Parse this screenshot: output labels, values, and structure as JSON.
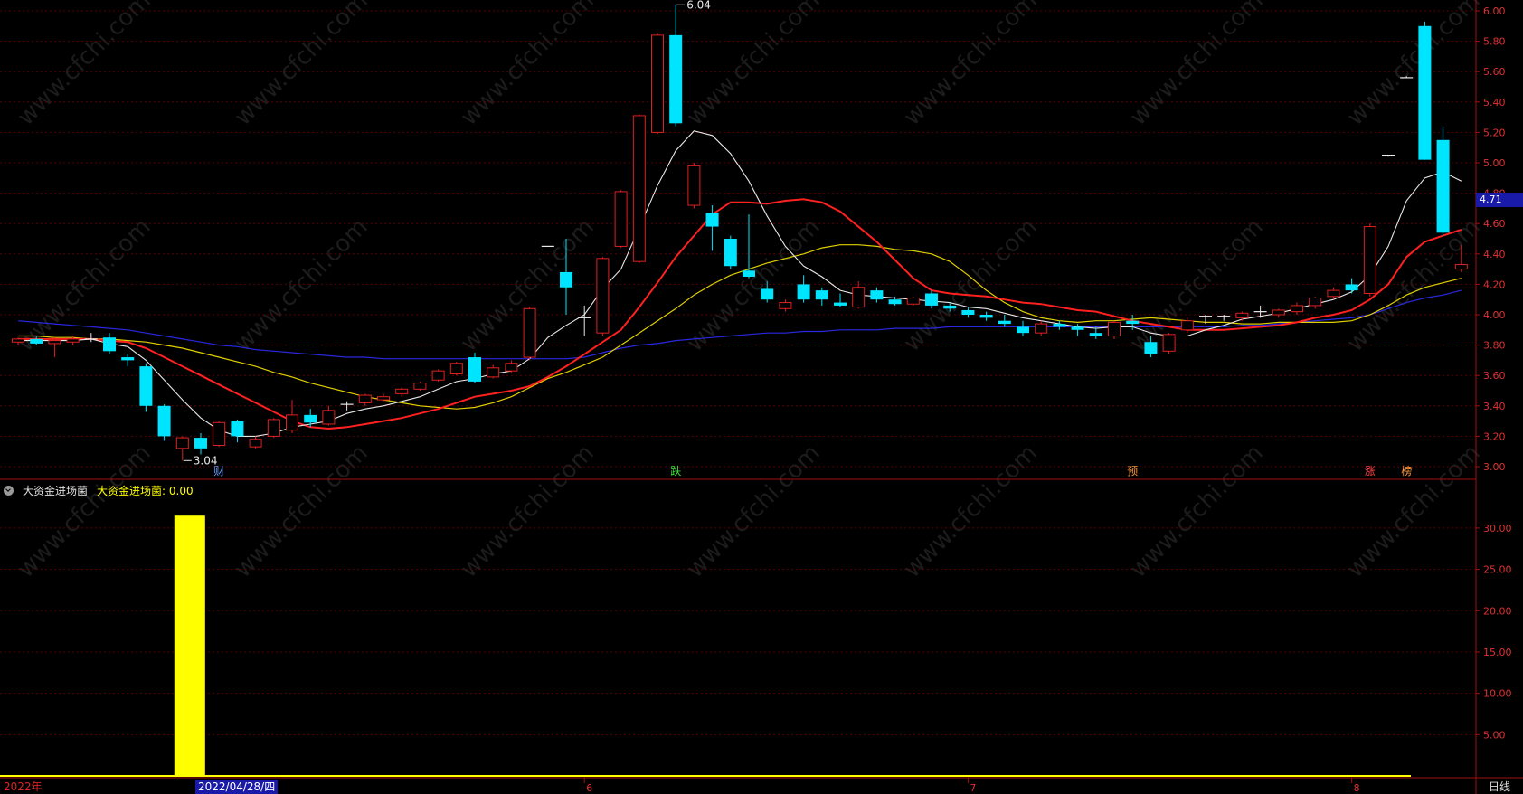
{
  "app": {
    "period_label": "日线",
    "year_label": "2022年",
    "cursor_date": "2022/04/28/四",
    "watermark": "www.cfchi.com"
  },
  "colors": {
    "background": "#000000",
    "up": "#e02020",
    "down": "#00e5ff",
    "ma5": "#e8e8e8",
    "ma10": "#ff2020",
    "ma20": "#e0d000",
    "ma60": "#2828e0",
    "grid": "#5a0000",
    "axis_text": "#e03030",
    "indicator_bar": "#ffff00"
  },
  "price_panel": {
    "y_ticks": [
      "6.00",
      "5.80",
      "5.60",
      "5.40",
      "5.20",
      "5.00",
      "4.80",
      "4.60",
      "4.40",
      "4.20",
      "4.00",
      "3.80",
      "3.60",
      "3.40",
      "3.20",
      "3.00"
    ],
    "last_price": "4.71",
    "high_label": "6.04",
    "low_label": "3.04",
    "markers": [
      {
        "text": "财",
        "color": "#6aa0ff",
        "candle": 11
      },
      {
        "text": "跌",
        "color": "#40e040",
        "candle": 36
      },
      {
        "text": "预",
        "color": "#ff9a40",
        "candle": 61
      },
      {
        "text": "涨",
        "color": "#ff4040",
        "candle": 74
      },
      {
        "text": "榜",
        "color": "#ff9a40",
        "candle": 76
      }
    ]
  },
  "indicator_panel": {
    "name": "大资金进场菌",
    "value_label": "大资金进场菌: 0.00",
    "y_ticks": [
      "30.00",
      "25.00",
      "20.00",
      "15.00",
      "10.00",
      "5.00"
    ],
    "bars": [
      {
        "candle": 9,
        "value": 31.5
      }
    ]
  },
  "x_axis": {
    "month_labels": [
      {
        "text": "6",
        "candle": 31
      },
      {
        "text": "7",
        "candle": 52
      },
      {
        "text": "8",
        "candle": 73
      }
    ]
  },
  "chart_data": {
    "type": "candlestick",
    "ylim": [
      3.0,
      6.0
    ],
    "candles": [
      {
        "o": 3.82,
        "h": 3.85,
        "l": 3.8,
        "c": 3.84
      },
      {
        "o": 3.84,
        "h": 3.86,
        "l": 3.8,
        "c": 3.81
      },
      {
        "o": 3.81,
        "h": 3.85,
        "l": 3.72,
        "c": 3.83
      },
      {
        "o": 3.82,
        "h": 3.86,
        "l": 3.8,
        "c": 3.84
      },
      {
        "o": 3.84,
        "h": 3.88,
        "l": 3.82,
        "c": 3.84
      },
      {
        "o": 3.85,
        "h": 3.88,
        "l": 3.74,
        "c": 3.76
      },
      {
        "o": 3.72,
        "h": 3.74,
        "l": 3.66,
        "c": 3.7
      },
      {
        "o": 3.66,
        "h": 3.68,
        "l": 3.36,
        "c": 3.4
      },
      {
        "o": 3.4,
        "h": 3.41,
        "l": 3.17,
        "c": 3.2
      },
      {
        "o": 3.12,
        "h": 3.2,
        "l": 3.04,
        "c": 3.19
      },
      {
        "o": 3.19,
        "h": 3.22,
        "l": 3.08,
        "c": 3.12
      },
      {
        "o": 3.14,
        "h": 3.3,
        "l": 3.13,
        "c": 3.29
      },
      {
        "o": 3.3,
        "h": 3.31,
        "l": 3.16,
        "c": 3.2
      },
      {
        "o": 3.13,
        "h": 3.2,
        "l": 3.12,
        "c": 3.18
      },
      {
        "o": 3.2,
        "h": 3.32,
        "l": 3.19,
        "c": 3.31
      },
      {
        "o": 3.24,
        "h": 3.44,
        "l": 3.22,
        "c": 3.34
      },
      {
        "o": 3.34,
        "h": 3.38,
        "l": 3.26,
        "c": 3.29
      },
      {
        "o": 3.28,
        "h": 3.4,
        "l": 3.27,
        "c": 3.37
      },
      {
        "o": 3.4,
        "h": 3.43,
        "l": 3.37,
        "c": 3.41
      },
      {
        "o": 3.42,
        "h": 3.48,
        "l": 3.4,
        "c": 3.47
      },
      {
        "o": 3.44,
        "h": 3.48,
        "l": 3.43,
        "c": 3.46
      },
      {
        "o": 3.48,
        "h": 3.52,
        "l": 3.46,
        "c": 3.51
      },
      {
        "o": 3.51,
        "h": 3.56,
        "l": 3.5,
        "c": 3.55
      },
      {
        "o": 3.57,
        "h": 3.64,
        "l": 3.56,
        "c": 3.63
      },
      {
        "o": 3.61,
        "h": 3.69,
        "l": 3.6,
        "c": 3.68
      },
      {
        "o": 3.72,
        "h": 3.75,
        "l": 3.55,
        "c": 3.56
      },
      {
        "o": 3.59,
        "h": 3.67,
        "l": 3.58,
        "c": 3.65
      },
      {
        "o": 3.63,
        "h": 3.7,
        "l": 3.62,
        "c": 3.68
      },
      {
        "o": 3.72,
        "h": 4.05,
        "l": 3.7,
        "c": 4.04
      },
      {
        "o": 4.45,
        "h": 4.45,
        "l": 4.45,
        "c": 4.45
      },
      {
        "o": 4.28,
        "h": 4.5,
        "l": 4.0,
        "c": 4.18
      },
      {
        "o": 3.98,
        "h": 4.06,
        "l": 3.86,
        "c": 3.98
      },
      {
        "o": 3.88,
        "h": 4.38,
        "l": 3.86,
        "c": 4.37
      },
      {
        "o": 4.45,
        "h": 4.82,
        "l": 4.44,
        "c": 4.81
      },
      {
        "o": 4.35,
        "h": 5.32,
        "l": 4.34,
        "c": 5.31
      },
      {
        "o": 5.2,
        "h": 5.85,
        "l": 5.19,
        "c": 5.84
      },
      {
        "o": 5.84,
        "h": 6.04,
        "l": 5.24,
        "c": 5.26
      },
      {
        "o": 4.72,
        "h": 5.0,
        "l": 4.7,
        "c": 4.98
      },
      {
        "o": 4.67,
        "h": 4.72,
        "l": 4.42,
        "c": 4.58
      },
      {
        "o": 4.5,
        "h": 4.52,
        "l": 4.3,
        "c": 4.32
      },
      {
        "o": 4.29,
        "h": 4.66,
        "l": 4.24,
        "c": 4.25
      },
      {
        "o": 4.17,
        "h": 4.22,
        "l": 4.08,
        "c": 4.1
      },
      {
        "o": 4.04,
        "h": 4.1,
        "l": 4.02,
        "c": 4.08
      },
      {
        "o": 4.2,
        "h": 4.26,
        "l": 4.08,
        "c": 4.1
      },
      {
        "o": 4.16,
        "h": 4.18,
        "l": 4.06,
        "c": 4.1
      },
      {
        "o": 4.08,
        "h": 4.14,
        "l": 4.05,
        "c": 4.06
      },
      {
        "o": 4.05,
        "h": 4.22,
        "l": 4.04,
        "c": 4.18
      },
      {
        "o": 4.16,
        "h": 4.18,
        "l": 4.08,
        "c": 4.1
      },
      {
        "o": 4.1,
        "h": 4.12,
        "l": 4.06,
        "c": 4.07
      },
      {
        "o": 4.07,
        "h": 4.12,
        "l": 4.06,
        "c": 4.11
      },
      {
        "o": 4.14,
        "h": 4.16,
        "l": 4.04,
        "c": 4.06
      },
      {
        "o": 4.06,
        "h": 4.08,
        "l": 4.02,
        "c": 4.04
      },
      {
        "o": 4.03,
        "h": 4.05,
        "l": 3.98,
        "c": 4.0
      },
      {
        "o": 4.0,
        "h": 4.02,
        "l": 3.96,
        "c": 3.98
      },
      {
        "o": 3.96,
        "h": 4.0,
        "l": 3.92,
        "c": 3.94
      },
      {
        "o": 3.92,
        "h": 3.96,
        "l": 3.86,
        "c": 3.88
      },
      {
        "o": 3.88,
        "h": 3.96,
        "l": 3.86,
        "c": 3.94
      },
      {
        "o": 3.94,
        "h": 3.96,
        "l": 3.9,
        "c": 3.92
      },
      {
        "o": 3.92,
        "h": 3.94,
        "l": 3.86,
        "c": 3.9
      },
      {
        "o": 3.88,
        "h": 3.92,
        "l": 3.84,
        "c": 3.86
      },
      {
        "o": 3.86,
        "h": 3.96,
        "l": 3.84,
        "c": 3.95
      },
      {
        "o": 3.96,
        "h": 4.0,
        "l": 3.9,
        "c": 3.94
      },
      {
        "o": 3.82,
        "h": 3.86,
        "l": 3.72,
        "c": 3.74
      },
      {
        "o": 3.76,
        "h": 3.88,
        "l": 3.74,
        "c": 3.87
      },
      {
        "o": 3.9,
        "h": 3.98,
        "l": 3.88,
        "c": 3.96
      },
      {
        "o": 3.98,
        "h": 4.0,
        "l": 3.94,
        "c": 3.99
      },
      {
        "o": 3.99,
        "h": 4.0,
        "l": 3.96,
        "c": 3.98
      },
      {
        "o": 3.98,
        "h": 4.02,
        "l": 3.96,
        "c": 4.01
      },
      {
        "o": 4.02,
        "h": 4.06,
        "l": 3.98,
        "c": 4.01
      },
      {
        "o": 4.0,
        "h": 4.04,
        "l": 3.98,
        "c": 4.03
      },
      {
        "o": 4.02,
        "h": 4.08,
        "l": 4.0,
        "c": 4.06
      },
      {
        "o": 4.06,
        "h": 4.12,
        "l": 4.04,
        "c": 4.11
      },
      {
        "o": 4.12,
        "h": 4.18,
        "l": 4.1,
        "c": 4.16
      },
      {
        "o": 4.2,
        "h": 4.24,
        "l": 4.14,
        "c": 4.16
      },
      {
        "o": 4.14,
        "h": 4.6,
        "l": 4.12,
        "c": 4.58
      },
      {
        "o": 5.04,
        "h": 5.05,
        "l": 5.04,
        "c": 5.05
      },
      {
        "o": 5.56,
        "h": 5.57,
        "l": 5.56,
        "c": 5.56
      },
      {
        "o": 5.9,
        "h": 5.93,
        "l": 5.02,
        "c": 5.02
      },
      {
        "o": 5.15,
        "h": 5.24,
        "l": 4.52,
        "c": 4.54
      },
      {
        "o": 4.3,
        "h": 4.46,
        "l": 4.28,
        "c": 4.33
      }
    ],
    "ma5": [
      3.83,
      3.83,
      3.83,
      3.83,
      3.84,
      3.81,
      3.79,
      3.7,
      3.57,
      3.44,
      3.32,
      3.24,
      3.2,
      3.2,
      3.22,
      3.26,
      3.28,
      3.3,
      3.35,
      3.38,
      3.4,
      3.43,
      3.46,
      3.51,
      3.56,
      3.58,
      3.61,
      3.63,
      3.71,
      3.85,
      3.93,
      4.0,
      4.17,
      4.3,
      4.57,
      4.85,
      5.08,
      5.21,
      5.18,
      5.06,
      4.88,
      4.65,
      4.45,
      4.32,
      4.25,
      4.16,
      4.13,
      4.12,
      4.11,
      4.1,
      4.09,
      4.08,
      4.05,
      4.04,
      4.01,
      3.98,
      3.96,
      3.94,
      3.92,
      3.91,
      3.92,
      3.92,
      3.88,
      3.86,
      3.86,
      3.9,
      3.93,
      3.97,
      3.99,
      4.01,
      4.04,
      4.07,
      4.1,
      4.15,
      4.26,
      4.45,
      4.75,
      4.9,
      4.94,
      4.88
    ],
    "ma10": [
      3.84,
      3.84,
      3.84,
      3.84,
      3.84,
      3.83,
      3.82,
      3.78,
      3.72,
      3.66,
      3.6,
      3.54,
      3.48,
      3.42,
      3.36,
      3.3,
      3.26,
      3.25,
      3.26,
      3.28,
      3.3,
      3.32,
      3.35,
      3.38,
      3.42,
      3.46,
      3.48,
      3.5,
      3.53,
      3.59,
      3.66,
      3.74,
      3.82,
      3.9,
      4.05,
      4.21,
      4.38,
      4.52,
      4.66,
      4.74,
      4.74,
      4.73,
      4.75,
      4.76,
      4.74,
      4.68,
      4.58,
      4.48,
      4.36,
      4.24,
      4.16,
      4.14,
      4.13,
      4.12,
      4.1,
      4.08,
      4.07,
      4.05,
      4.03,
      4.02,
      3.99,
      3.96,
      3.94,
      3.92,
      3.9,
      3.9,
      3.9,
      3.91,
      3.92,
      3.93,
      3.95,
      3.98,
      4.0,
      4.03,
      4.1,
      4.2,
      4.38,
      4.48,
      4.52,
      4.56
    ],
    "ma20": [
      3.86,
      3.86,
      3.85,
      3.85,
      3.84,
      3.84,
      3.83,
      3.82,
      3.8,
      3.78,
      3.75,
      3.72,
      3.69,
      3.66,
      3.62,
      3.59,
      3.55,
      3.52,
      3.49,
      3.46,
      3.44,
      3.42,
      3.4,
      3.39,
      3.38,
      3.39,
      3.42,
      3.46,
      3.52,
      3.58,
      3.62,
      3.67,
      3.72,
      3.8,
      3.88,
      3.96,
      4.04,
      4.13,
      4.2,
      4.26,
      4.3,
      4.34,
      4.37,
      4.4,
      4.44,
      4.46,
      4.46,
      4.45,
      4.43,
      4.42,
      4.4,
      4.35,
      4.26,
      4.16,
      4.08,
      4.02,
      3.98,
      3.96,
      3.95,
      3.96,
      3.96,
      3.97,
      3.98,
      3.97,
      3.96,
      3.95,
      3.95,
      3.94,
      3.94,
      3.95,
      3.95,
      3.95,
      3.95,
      3.96,
      4.0,
      4.06,
      4.13,
      4.18,
      4.21,
      4.24
    ],
    "ma60": [
      3.96,
      3.95,
      3.94,
      3.93,
      3.92,
      3.91,
      3.9,
      3.88,
      3.86,
      3.84,
      3.82,
      3.8,
      3.79,
      3.77,
      3.76,
      3.75,
      3.74,
      3.73,
      3.72,
      3.72,
      3.71,
      3.71,
      3.71,
      3.71,
      3.71,
      3.71,
      3.71,
      3.71,
      3.71,
      3.71,
      3.71,
      3.72,
      3.75,
      3.78,
      3.8,
      3.81,
      3.83,
      3.84,
      3.85,
      3.86,
      3.87,
      3.88,
      3.88,
      3.89,
      3.89,
      3.9,
      3.9,
      3.9,
      3.91,
      3.91,
      3.91,
      3.92,
      3.92,
      3.92,
      3.92,
      3.92,
      3.92,
      3.92,
      3.92,
      3.92,
      3.92,
      3.92,
      3.92,
      3.92,
      3.92,
      3.92,
      3.92,
      3.93,
      3.93,
      3.94,
      3.95,
      3.96,
      3.97,
      3.98,
      4.0,
      4.04,
      4.08,
      4.11,
      4.13,
      4.16
    ]
  }
}
